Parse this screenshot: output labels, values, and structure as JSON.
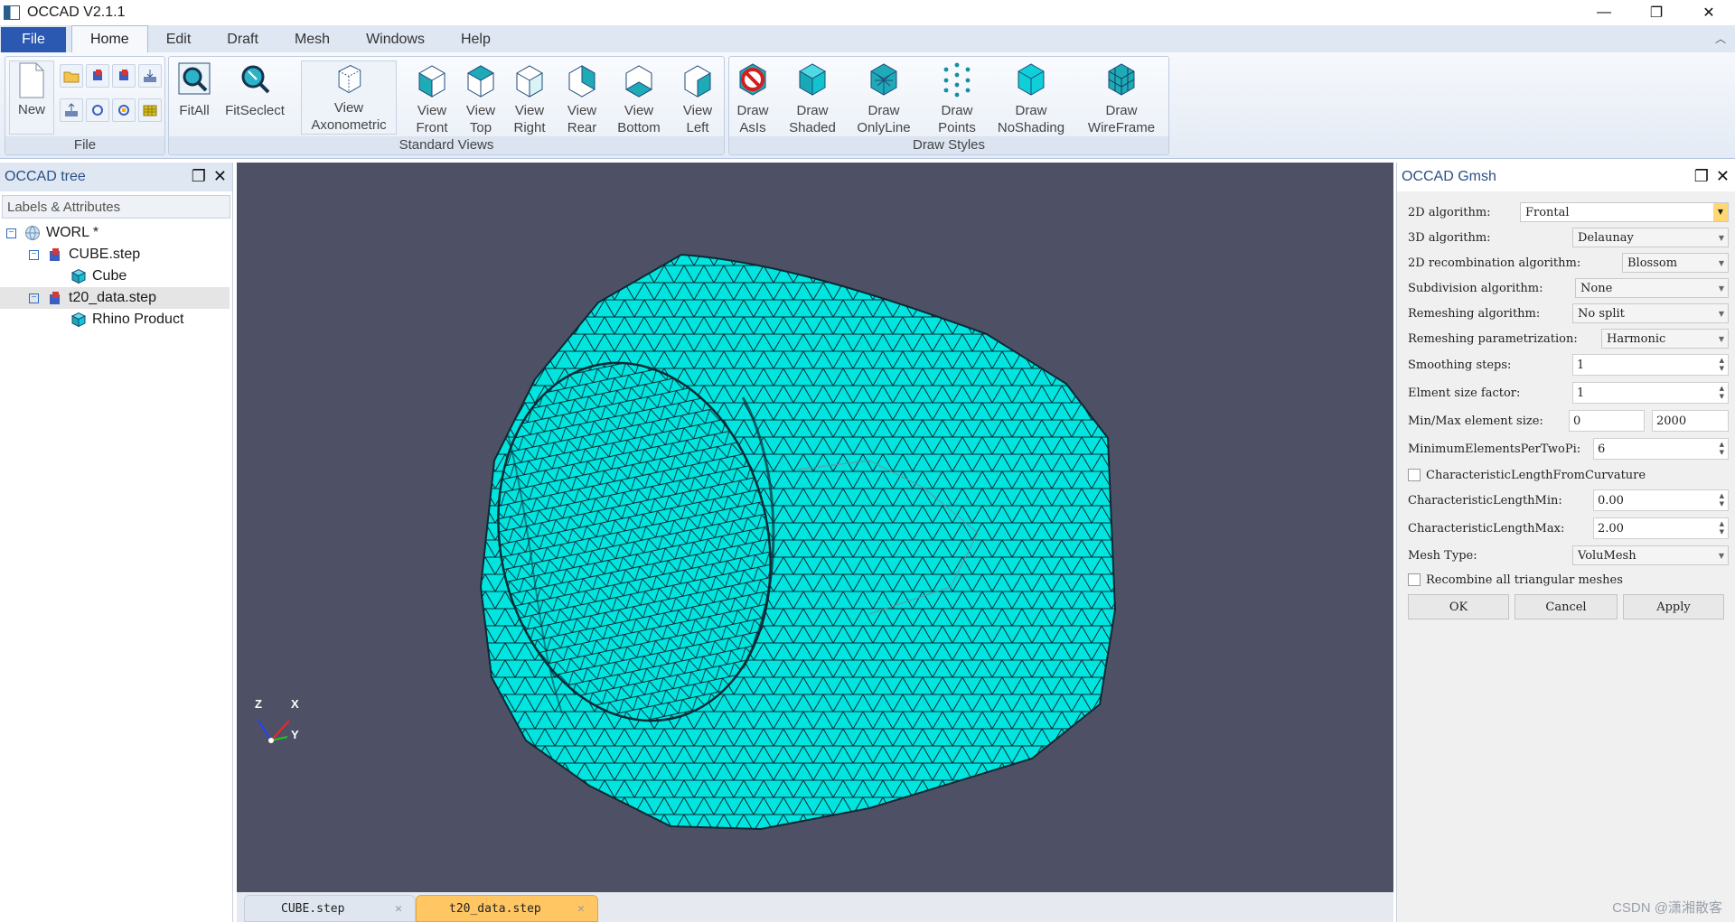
{
  "window": {
    "title": "OCCAD V2.1.1",
    "minimize": "—",
    "restore": "❐",
    "close": "✕"
  },
  "menu": {
    "items": [
      "File",
      "Home",
      "Edit",
      "Draft",
      "Mesh",
      "Windows",
      "Help"
    ],
    "active": "Home",
    "collapse": "︿"
  },
  "ribbon": {
    "file_group": {
      "label": "File",
      "new_label": "New"
    },
    "standard_views": {
      "label": "Standard Views",
      "buttons": [
        {
          "l1": "FitAll",
          "l2": ""
        },
        {
          "l1": "FitSeclect",
          "l2": ""
        },
        {
          "l1": "View",
          "l2": "Axonometric"
        },
        {
          "l1": "View",
          "l2": "Front"
        },
        {
          "l1": "View",
          "l2": "Top"
        },
        {
          "l1": "View",
          "l2": "Right"
        },
        {
          "l1": "View",
          "l2": "Rear"
        },
        {
          "l1": "View",
          "l2": "Bottom"
        },
        {
          "l1": "View",
          "l2": "Left"
        }
      ]
    },
    "draw_styles": {
      "label": "Draw Styles",
      "buttons": [
        {
          "l1": "Draw",
          "l2": "AsIs"
        },
        {
          "l1": "Draw",
          "l2": "Shaded"
        },
        {
          "l1": "Draw",
          "l2": "OnlyLine"
        },
        {
          "l1": "Draw",
          "l2": "Points"
        },
        {
          "l1": "Draw",
          "l2": "NoShading"
        },
        {
          "l1": "Draw",
          "l2": "WireFrame"
        }
      ]
    }
  },
  "tree_panel": {
    "title": "OCCAD tree",
    "column_header": "Labels & Attributes",
    "nodes": [
      "WORL *",
      "CUBE.step",
      "Cube",
      "t20_data.step",
      "Rhino Product"
    ],
    "selected": "t20_data.step"
  },
  "gmsh_panel": {
    "title": "OCCAD Gmsh",
    "fields": {
      "alg2d": {
        "label": "2D algorithm:",
        "value": "Frontal"
      },
      "alg3d": {
        "label": "3D algorithm:",
        "value": "Delaunay"
      },
      "recomb2d": {
        "label": "2D recombination algorithm:",
        "value": "Blossom"
      },
      "subdiv": {
        "label": "Subdivision algorithm:",
        "value": "None"
      },
      "remesh": {
        "label": "Remeshing algorithm:",
        "value": "No split"
      },
      "remesh_param": {
        "label": "Remeshing parametrization:",
        "value": "Harmonic"
      },
      "smoothing": {
        "label": "Smoothing steps:",
        "value": "1"
      },
      "size_factor": {
        "label": "Elment size factor:",
        "value": "1"
      },
      "minmax": {
        "label": "Min/Max element size:",
        "min": "0",
        "max": "2000"
      },
      "min_per_2pi": {
        "label": "MinimumElementsPerTwoPi:",
        "value": "6"
      },
      "char_len_curv": {
        "label": "CharacteristicLengthFromCurvature",
        "checked": false
      },
      "char_len_min": {
        "label": "CharacteristicLengthMin:",
        "value": "0.00"
      },
      "char_len_max": {
        "label": "CharacteristicLengthMax:",
        "value": "2.00"
      },
      "mesh_type": {
        "label": "Mesh Type:",
        "value": "VoluMesh"
      },
      "recombine_all": {
        "label": "Recombine all triangular meshes",
        "checked": false
      }
    },
    "buttons": {
      "ok": "OK",
      "cancel": "Cancel",
      "apply": "Apply"
    }
  },
  "viewport": {
    "axes": {
      "z": "Z",
      "x": "X",
      "y": "Y"
    },
    "mesh_color": "#00e5e0",
    "background": "#4e5166"
  },
  "document_tabs": [
    {
      "label": "CUBE.step",
      "active": false,
      "close": "✕"
    },
    {
      "label": "t20_data.step",
      "active": true,
      "close": "✕"
    }
  ],
  "watermark": "CSDN @潇湘散客"
}
